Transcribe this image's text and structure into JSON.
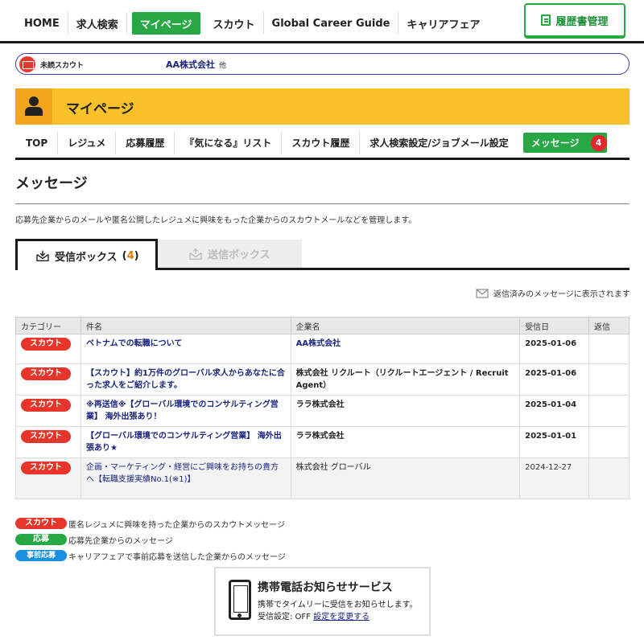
{
  "topnav": {
    "items": [
      "HOME",
      "求人検索",
      "マイページ",
      "スカウト",
      "Global Career Guide",
      "キャリアフェア"
    ],
    "active_index": 2,
    "resume_button": "履歴書管理"
  },
  "scout_bar": {
    "label": "未読スカウト",
    "company": "AA株式会社",
    "other": "他"
  },
  "mypage_header": {
    "title": "マイページ"
  },
  "subnav": {
    "items": [
      "TOP",
      "レジュメ",
      "応募履歴",
      "『気になる』リスト",
      "スカウト履歴",
      "求人検索設定/ジョブメール設定"
    ],
    "messages_label": "メッセージ",
    "messages_count": "4"
  },
  "page": {
    "title": "メッセージ",
    "description": "応募先企業からのメールや匿名公開したレジュメに興味をもった企業からのスカウトメールなどを管理します。"
  },
  "tabs": {
    "inbox_label": "受信ボックス",
    "inbox_count": "4",
    "outbox_label": "送信ボックス"
  },
  "reply_note": "返信済みのメッセージに表示されます",
  "table": {
    "headers": [
      "カテゴリー",
      "件名",
      "企業名",
      "受信日",
      "返信"
    ],
    "rows": [
      {
        "category": "スカウト",
        "subject": "ベトナムでの転職について",
        "company": "AA株式会社",
        "date": "2025-01-06",
        "read": false
      },
      {
        "category": "スカウト",
        "subject": "【スカウト】約1万件のグローバル求人からあなたに合った求人をご紹介します。",
        "company": "株式会社 リクルート（リクルートエージェント / Recruit Agent）",
        "date": "2025-01-06",
        "read": false
      },
      {
        "category": "スカウト",
        "subject": "※再送信※【グローバル環境でのコンサルティング営業】 海外出張あり！",
        "company": "ララ株式会社",
        "date": "2025-01-04",
        "read": false
      },
      {
        "category": "スカウト",
        "subject": "【グローバル環境でのコンサルティング営業】 海外出張あり★",
        "company": "ララ株式会社",
        "date": "2025-01-01",
        "read": false
      },
      {
        "category": "スカウト",
        "subject": "企画・マーケティング・経営にご興味をお持ちの貴方へ【転職支援実績No.1(※1)】",
        "company": "株式会社 グローバル",
        "date": "2024-12-27",
        "read": true
      }
    ]
  },
  "legend": [
    {
      "tag": "スカウト",
      "text": "匿名レジュメに興味を持った企業からのスカウトメッセージ",
      "kind": "scout"
    },
    {
      "tag": "応募",
      "text": "応募先企業からのメッセージ",
      "kind": "oubo"
    },
    {
      "tag": "事前応募",
      "text": "キャリアフェアで事前応募を送信した企業からのメッセージ",
      "kind": "jizen"
    }
  ],
  "mobile_service": {
    "title": "携帯電話お知らせサービス",
    "line1": "携帯でタイムリーに受信をお知らせします。",
    "status_label": "受信設定: OFF",
    "change_link": "設定を変更する"
  },
  "colors": {
    "green": "#27a844",
    "yellow": "#f8c12a",
    "red": "#e8352b",
    "navy": "#1a237e"
  }
}
